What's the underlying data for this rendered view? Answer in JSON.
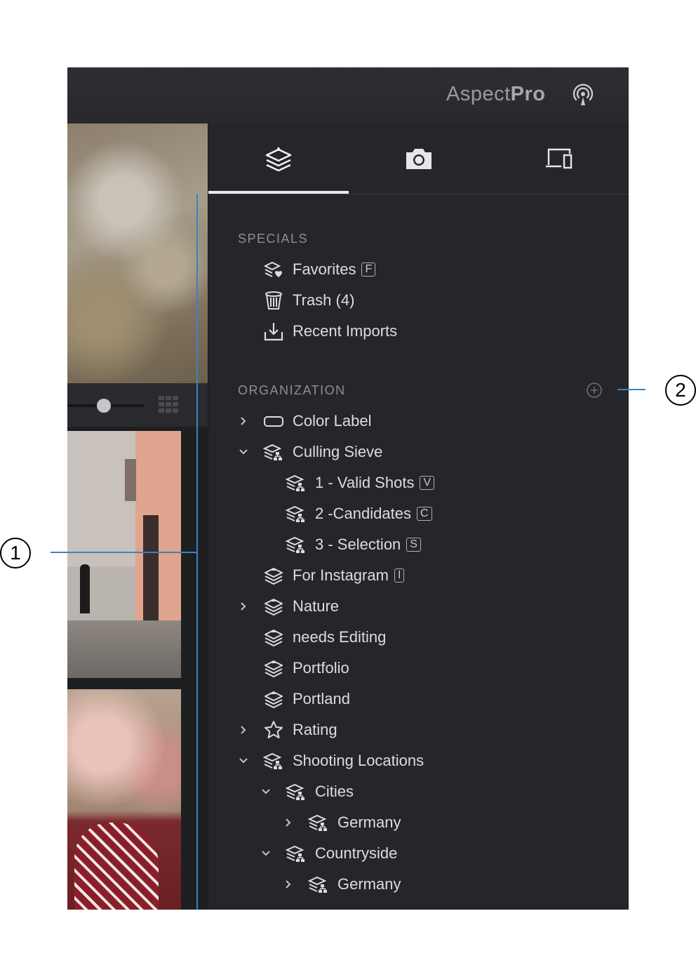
{
  "app": {
    "brand_light": "Aspect",
    "brand_bold": "Pro"
  },
  "tabs": [
    {
      "name": "library",
      "icon": "layers-icon",
      "active": true
    },
    {
      "name": "camera",
      "icon": "camera-icon",
      "active": false
    },
    {
      "name": "devices",
      "icon": "devices-icon",
      "active": false
    }
  ],
  "specials": {
    "title": "SPECIALS",
    "items": [
      {
        "label": "Favorites",
        "key": "F",
        "icon": "favorites-icon"
      },
      {
        "label": "Trash (4)",
        "key": "",
        "icon": "trash-icon"
      },
      {
        "label": "Recent Imports",
        "key": "",
        "icon": "import-icon"
      }
    ]
  },
  "organization": {
    "title": "ORGANIZATION",
    "items": [
      {
        "label": "Color Label",
        "key": "",
        "chevron": "right",
        "icon": "color-label-icon"
      },
      {
        "label": "Culling Sieve",
        "key": "",
        "chevron": "down",
        "icon": "smart-album-icon"
      },
      {
        "label": "1 - Valid Shots",
        "key": "V",
        "chevron": "",
        "icon": "smart-album-icon"
      },
      {
        "label": "2 -Candidates",
        "key": "C",
        "chevron": "",
        "icon": "smart-album-icon"
      },
      {
        "label": "3 - Selection",
        "key": "S",
        "chevron": "",
        "icon": "smart-album-icon"
      },
      {
        "label": "For Instagram",
        "key": "I",
        "chevron": "",
        "icon": "album-icon"
      },
      {
        "label": "Nature",
        "key": "",
        "chevron": "right",
        "icon": "album-icon"
      },
      {
        "label": "needs Editing",
        "key": "",
        "chevron": "",
        "icon": "album-icon"
      },
      {
        "label": "Portfolio",
        "key": "",
        "chevron": "",
        "icon": "album-icon"
      },
      {
        "label": "Portland",
        "key": "",
        "chevron": "",
        "icon": "album-icon"
      },
      {
        "label": "Rating",
        "key": "",
        "chevron": "right",
        "icon": "star-icon"
      },
      {
        "label": "Shooting Locations",
        "key": "",
        "chevron": "down",
        "icon": "smart-album-icon"
      },
      {
        "label": "Cities",
        "key": "",
        "chevron": "down",
        "icon": "smart-album-icon"
      },
      {
        "label": "Germany",
        "key": "",
        "chevron": "right",
        "icon": "smart-album-icon"
      },
      {
        "label": "Countryside",
        "key": "",
        "chevron": "down",
        "icon": "smart-album-icon"
      },
      {
        "label": "Germany",
        "key": "",
        "chevron": "right",
        "icon": "smart-album-icon"
      }
    ]
  },
  "callouts": [
    "1",
    "2"
  ],
  "colors": {
    "accent_callout": "#3b82c4",
    "panel_bg": "#25262a",
    "text": "#dcdde0"
  }
}
